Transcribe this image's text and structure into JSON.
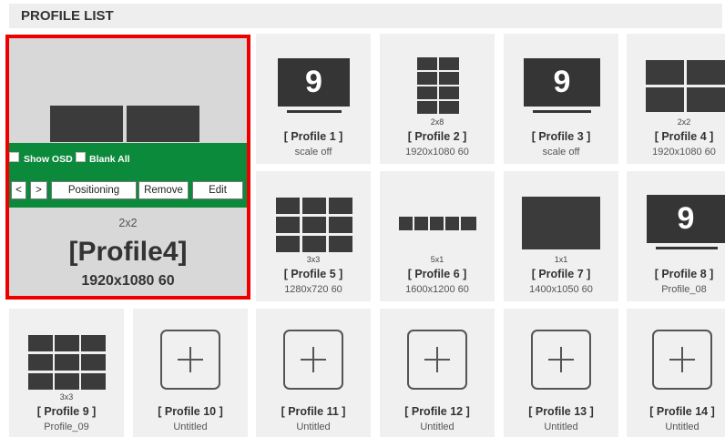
{
  "header": {
    "title": "PROFILE LIST"
  },
  "selected": {
    "layout": "2x2",
    "name": "[Profile4]",
    "resolution": "1920x1080 60",
    "show_osd": "Show OSD",
    "blank_all": "Blank All",
    "prev_label": "<",
    "next_label": ">",
    "positioning_label": "Positioning",
    "remove_label": "Remove",
    "edit_label": "Edit"
  },
  "profiles": [
    {
      "title": "[ Profile 1 ]",
      "sub": "scale off",
      "layout": "",
      "thumb": "9"
    },
    {
      "title": "[ Profile 2 ]",
      "sub": "1920x1080 60",
      "layout": "2x8",
      "thumb": "grid"
    },
    {
      "title": "[ Profile 3 ]",
      "sub": "scale off",
      "layout": "",
      "thumb": "9"
    },
    {
      "title": "[ Profile 4 ]",
      "sub": "1920x1080 60",
      "layout": "2x2",
      "thumb": "grid"
    },
    {
      "title": "[ Profile 5 ]",
      "sub": "1280x720 60",
      "layout": "3x3",
      "thumb": "grid"
    },
    {
      "title": "[ Profile 6 ]",
      "sub": "1600x1200 60",
      "layout": "5x1",
      "thumb": "grid"
    },
    {
      "title": "[ Profile 7 ]",
      "sub": "1400x1050 60",
      "layout": "1x1",
      "thumb": "grid"
    },
    {
      "title": "[ Profile 8 ]",
      "sub": "Profile_08",
      "layout": "",
      "thumb": "9"
    },
    {
      "title": "[ Profile 9 ]",
      "sub": "Profile_09",
      "layout": "3x3",
      "thumb": "grid"
    },
    {
      "title": "[ Profile 10 ]",
      "sub": "Untitled",
      "layout": "",
      "thumb": "add"
    },
    {
      "title": "[ Profile 11 ]",
      "sub": "Untitled",
      "layout": "",
      "thumb": "add"
    },
    {
      "title": "[ Profile 12 ]",
      "sub": "Untitled",
      "layout": "",
      "thumb": "add"
    },
    {
      "title": "[ Profile 13 ]",
      "sub": "Untitled",
      "layout": "",
      "thumb": "add"
    },
    {
      "title": "[ Profile 14 ]",
      "sub": "Untitled",
      "layout": "",
      "thumb": "add"
    }
  ],
  "colors": {
    "selected_border": "#ee0000",
    "control_bar": "#0c8a3c",
    "tile_bg": "#f0f0f0",
    "thumb": "#3b3b3b"
  }
}
